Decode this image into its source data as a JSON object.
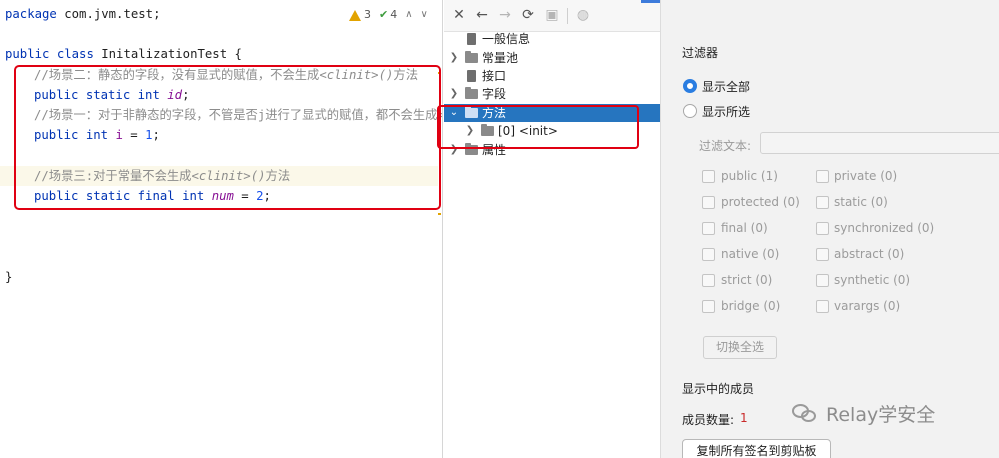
{
  "editor": {
    "inspections": {
      "warnings": "3",
      "weak_warnings": "4"
    },
    "line_package_kw": "package",
    "line_package_name": " com.jvm.test;",
    "class_decl": {
      "kw_public": "public",
      "kw_class": " class",
      "name": " InitalizationTest {"
    },
    "comment_2_pre": "//场景二：静态的字段，没有显式的赋值，不会生成",
    "comment_2_clinit": "<clinit>()",
    "comment_2_post": "方法",
    "field_id": {
      "mods": "public static int",
      "name": "id",
      "semi": ";"
    },
    "comment_1": "//场景一：对于非静态的字段，不管是否j进行了显式的赋值，都不会生成<c",
    "field_i": {
      "mods": "public int",
      "name": "i",
      "rest_eq": " = ",
      "value": "1",
      "semi": ";"
    },
    "comment_3_pre": "//场景三:对于常量不会生成",
    "comment_3_clinit": "<clinit>()",
    "comment_3_post": "方法",
    "field_num": {
      "mods": "public static final int",
      "name": "num",
      "rest_eq": " = ",
      "value": "2",
      "semi": ";"
    },
    "close_brace": "}"
  },
  "toolbar": {
    "icons": [
      "close-icon",
      "back-icon",
      "forward-icon",
      "refresh-icon",
      "save-icon",
      "web-icon"
    ]
  },
  "tree": {
    "items": [
      {
        "label": "一般信息",
        "icon": "document-icon",
        "expandable": false
      },
      {
        "label": "常量池",
        "icon": "folder-icon",
        "expandable": true
      },
      {
        "label": "接口",
        "icon": "document-icon",
        "expandable": false
      },
      {
        "label": "字段",
        "icon": "folder-icon",
        "expandable": true
      },
      {
        "label": "方法",
        "icon": "folder-icon",
        "expandable": true,
        "expanded": true,
        "selected": true
      },
      {
        "label": "[0] <init>",
        "icon": "folder-icon",
        "expandable": true,
        "child": true
      },
      {
        "label": "属性",
        "icon": "folder-icon",
        "expandable": true
      }
    ]
  },
  "filter_panel": {
    "title": "过滤器",
    "radio_all": "显示全部",
    "radio_selected": "显示所选",
    "filter_text_label": "过滤文本:",
    "filter_text_value": "",
    "checkboxes_left": [
      "public (1)",
      "protected (0)",
      "final (0)",
      "native (0)",
      "strict (0)",
      "bridge (0)"
    ],
    "checkboxes_right": [
      "private (0)",
      "static (0)",
      "synchronized (0)",
      "abstract (0)",
      "synthetic (0)",
      "varargs (0)"
    ],
    "toggle_button": "切换全选",
    "members_title": "显示中的成员",
    "member_count_label": "成员数量:",
    "member_count_value": "1",
    "copy_button": "复制所有签名到剪贴板"
  },
  "watermark": {
    "text": "Relay学安全"
  },
  "colors": {
    "accent": "#2675bf",
    "annotation_red": "#e00012",
    "keyword": "#0033b3",
    "comment": "#8c8c8c"
  }
}
